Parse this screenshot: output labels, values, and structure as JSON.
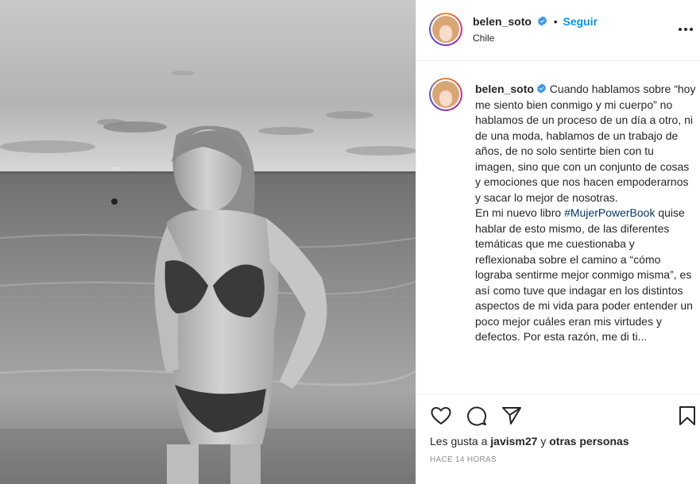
{
  "post": {
    "username": "belen_soto",
    "verified": true,
    "separator": "•",
    "follow_label": "Seguir",
    "location": "Chile",
    "more_options_icon": "ellipsis-icon"
  },
  "caption": {
    "username": "belen_soto",
    "paragraph1": "Cuando hablamos sobre “hoy me siento bien conmigo y mi cuerpo” no hablamos de un proceso de un día a otro, ni de una moda, hablamos de un trabajo de años, de no solo sentirte bien con tu imagen, sino que con un conjunto de cosas y emociones que nos hacen empoderarnos y sacar lo mejor de nosotras.",
    "p2_before": "En mi nuevo libro ",
    "hashtag": "#MujerPowerBook",
    "p2_after": " quise hablar de esto mismo, de las diferentes temáticas que me cuestionaba y reflexionaba sobre el camino a “cómo lograba sentirme mejor conmigo misma”, es así como tuve que indagar en los distintos aspectos de mi vida para poder entender un poco mejor cuáles eran mis virtudes y defectos. Por esta razón, me di ti..."
  },
  "actions": {
    "like_icon": "heart-icon",
    "comment_icon": "comment-bubble-icon",
    "share_icon": "paper-plane-icon",
    "save_icon": "bookmark-icon"
  },
  "likes": {
    "prefix": "Les gusta a ",
    "user": "javism27",
    "middle": " y ",
    "others": "otras personas"
  },
  "timestamp": "HACE 14 HORAS",
  "colors": {
    "accent": "#0095f6",
    "verified": "#3897f0",
    "hashtag": "#00376b",
    "muted": "#8e8e8e"
  }
}
